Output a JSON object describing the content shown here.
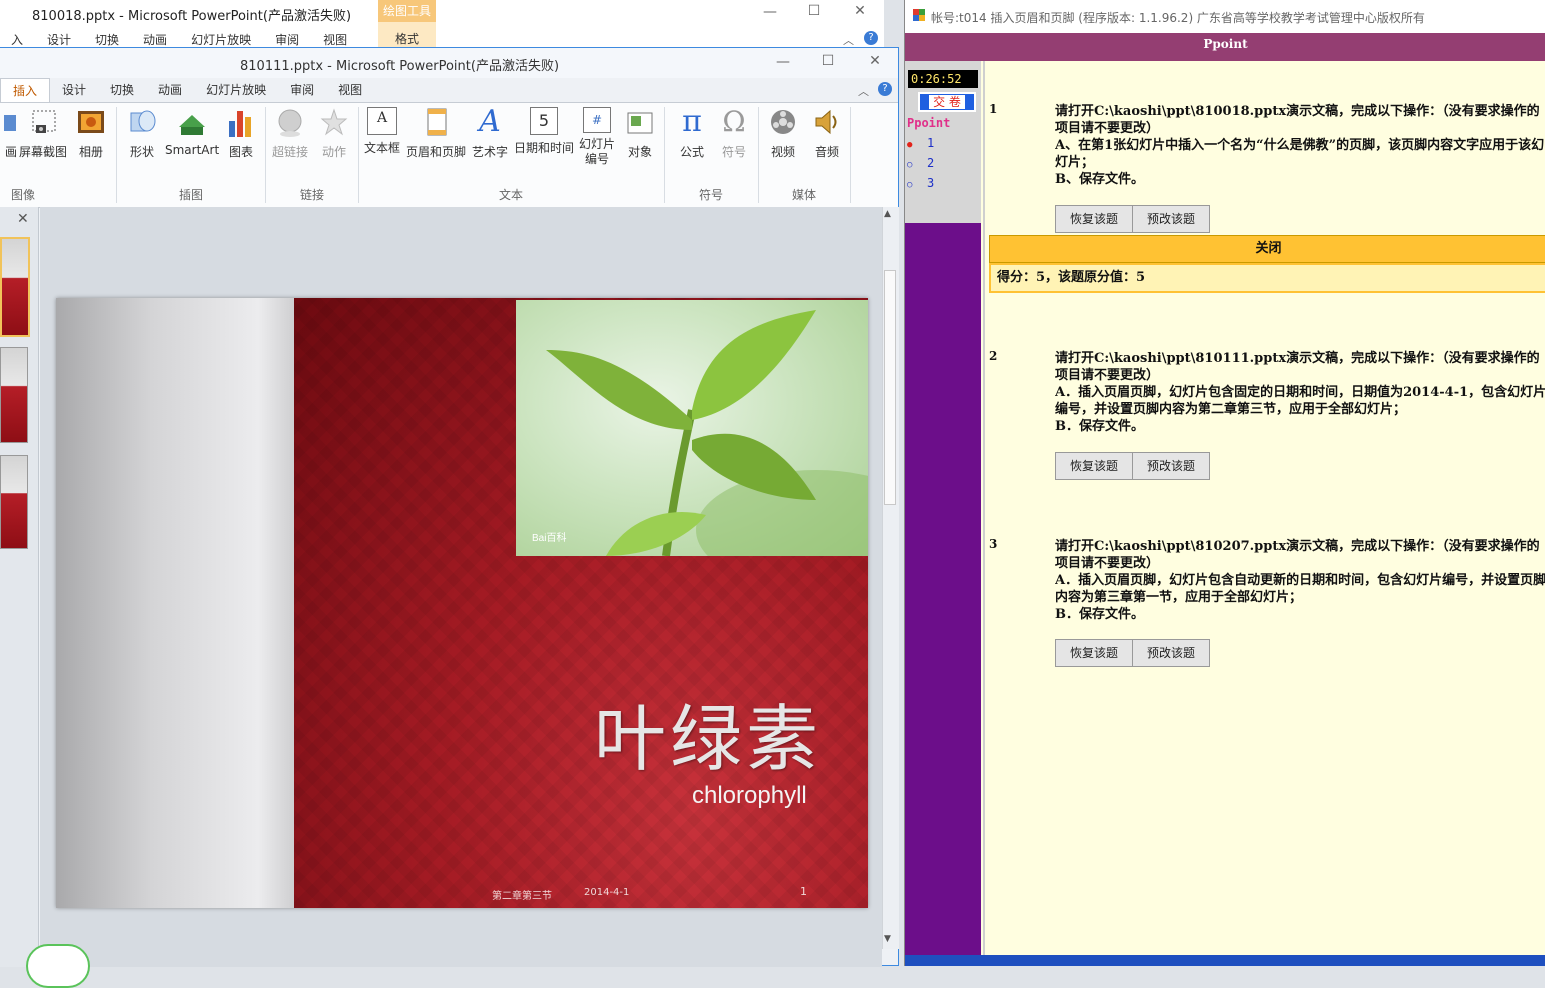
{
  "back_window": {
    "title": "810018.pptx  -  Microsoft PowerPoint(产品激活失败)",
    "context_tab_header": "绘图工具",
    "context_tab": "格式",
    "tabs": [
      "入",
      "设计",
      "切换",
      "动画",
      "幻灯片放映",
      "审阅",
      "视图"
    ]
  },
  "front_window": {
    "title": "810111.pptx  -  Microsoft PowerPoint(产品激活失败)",
    "tabs": [
      "插入",
      "设计",
      "切换",
      "动画",
      "幻灯片放映",
      "审阅",
      "视图"
    ],
    "active_tab": "插入"
  },
  "ribbon": {
    "buttons": {
      "screen_fragment": "画",
      "screenshot": "屏幕截图",
      "album": "相册",
      "shapes": "形状",
      "smartart": "SmartArt",
      "chart": "图表",
      "hyperlink": "超链接",
      "action": "动作",
      "textbox": "文本框",
      "header_footer": "页眉和页脚",
      "wordart": "艺术字",
      "datetime": "日期和时间",
      "slide_number_l1": "幻灯片",
      "slide_number_l2": "编号",
      "object": "对象",
      "equation": "公式",
      "symbol": "符号",
      "video": "视频",
      "audio": "音频"
    },
    "groups": {
      "images": "图像",
      "illustrations": "插图",
      "links": "链接",
      "text": "文本",
      "symbols": "符号",
      "media": "媒体"
    },
    "equation_glyph": "π",
    "symbol_glyph": "Ω",
    "wordart_glyph": "A",
    "datetime_glyph": "5",
    "slidenum_glyph": "#",
    "textbox_glyph": "A"
  },
  "slide": {
    "title": "叶绿素",
    "subtitle": "chlorophyll",
    "footer": "第二章第三节",
    "date": "2014-4-1",
    "number": "1",
    "photo_watermark": "Bai百科"
  },
  "exam": {
    "window_title": "帐号:t014  插入页眉和页脚 (程序版本: 1.1.96.2)  广东省高等学校教学考试管理中心版权所有",
    "app_name": "Ppoint",
    "timer": "0:26:52",
    "submit_label": "交 卷",
    "nav_label": "Ppoint",
    "nav_items": [
      {
        "marker": "●",
        "num": "1"
      },
      {
        "marker": "○",
        "num": "2"
      },
      {
        "marker": "○",
        "num": "3"
      }
    ],
    "colors": {
      "current_marker": "#e2231a",
      "other_marker": "#1c2fc8"
    },
    "restore_label": "恢复该题",
    "preview_label": "预改该题",
    "close_label": "关闭",
    "score_text": "得分：5，该题原分值：5",
    "questions": [
      {
        "num": "1",
        "text": "请打开C:\\kaoshi\\ppt\\810018.pptx演示文稿，完成以下操作：（没有要求操作的项目请不要更改）\nA、在第1张幻灯片中插入一个名为“什么是佛教”的页脚，该页脚内容文字应用于该幻灯片；\nB、保存文件。"
      },
      {
        "num": "2",
        "text": "请打开C:\\kaoshi\\ppt\\810111.pptx演示文稿，完成以下操作：（没有要求操作的项目请不要更改）\nA．插入页眉页脚，幻灯片包含固定的日期和时间，日期值为2014-4-1，包含幻灯片编号，并设置页脚内容为第二章第三节，应用于全部幻灯片；\nB．保存文件。"
      },
      {
        "num": "3",
        "text": "请打开C:\\kaoshi\\ppt\\810207.pptx演示文稿，完成以下操作：（没有要求操作的项目请不要更改）\nA．插入页眉页脚，幻灯片包含自动更新的日期和时间，包含幻灯片编号，并设置页脚内容为第三章第一节，应用于全部幻灯片；\nB．保存文件。"
      }
    ]
  }
}
